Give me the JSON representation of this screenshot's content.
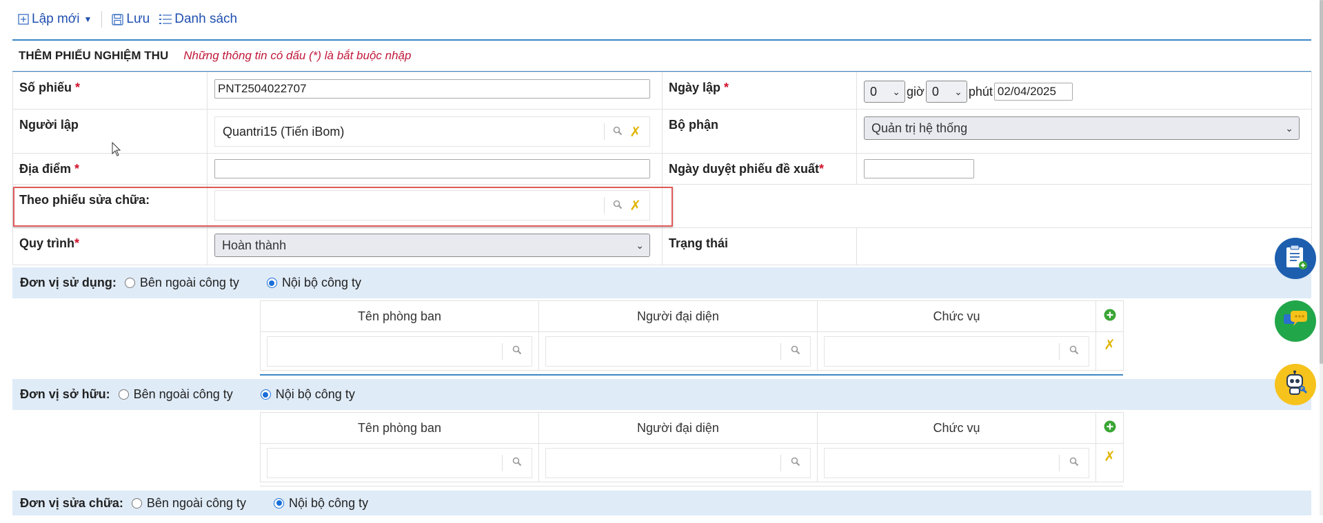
{
  "toolbar": {
    "new_label": "Lập mới",
    "save_label": "Lưu",
    "list_label": "Danh sách"
  },
  "header": {
    "title": "THÊM PHIẾU NGHIỆM THU",
    "note": "Những thông tin có dấu (*) là bắt buộc nhập"
  },
  "form": {
    "so_phieu_label": "Số phiếu",
    "so_phieu_value": "PNT2504022707",
    "ngay_lap_label": "Ngày lập",
    "hour_value": "0",
    "hour_unit": "giờ",
    "minute_value": "0",
    "minute_unit": "phút",
    "date_value": "02/04/2025",
    "nguoi_lap_label": "Người lập",
    "nguoi_lap_value": "Quantri15 (Tiến iBom)",
    "bo_phan_label": "Bộ phận",
    "bo_phan_value": "Quản trị hệ thống",
    "dia_diem_label": "Địa điểm",
    "dia_diem_value": "",
    "ngay_duyet_label": "Ngày duyệt phiếu đề xuất",
    "ngay_duyet_value": "",
    "theo_phieu_label": "Theo phiếu sửa chữa:",
    "theo_phieu_value": "",
    "quy_trinh_label": "Quy trình",
    "quy_trinh_value": "Hoàn thành",
    "trang_thai_label": "Trạng thái",
    "required_mark": "*"
  },
  "don_vi_su_dung": {
    "label": "Đơn vị sử dụng:",
    "option_outside": "Bên ngoài công ty",
    "option_internal": "Nội bộ công ty",
    "selected": "internal"
  },
  "don_vi_so_huu": {
    "label": "Đơn vị sở hữu:",
    "option_outside": "Bên ngoài công ty",
    "option_internal": "Nội bộ công ty",
    "selected": "internal"
  },
  "don_vi_sua_chua": {
    "label": "Đơn vị sửa chữa:",
    "option_outside": "Bên ngoài công ty",
    "option_internal": "Nội bộ công ty",
    "selected": "internal"
  },
  "unit_table": {
    "col_department": "Tên phòng ban",
    "col_representative": "Người đại diện",
    "col_position": "Chức vụ"
  },
  "colors": {
    "accent_blue": "#3b86c6",
    "required_red": "#d0102a",
    "band_bg": "#dfebf7",
    "highlight": "#e05a5a"
  }
}
